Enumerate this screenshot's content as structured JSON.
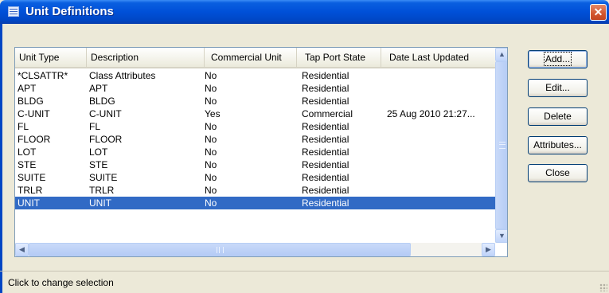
{
  "window": {
    "title": "Unit Definitions",
    "close_glyph": "✕"
  },
  "table": {
    "columns": [
      "Unit Type",
      "Description",
      "Commercial Unit",
      "Tap Port State",
      "Date Last Updated"
    ],
    "rows": [
      [
        "*CLSATTR*",
        "Class Attributes",
        "No",
        "Residential",
        ""
      ],
      [
        "APT",
        "APT",
        "No",
        "Residential",
        ""
      ],
      [
        "BLDG",
        "BLDG",
        "No",
        "Residential",
        ""
      ],
      [
        "C-UNIT",
        "C-UNIT",
        "Yes",
        "Commercial",
        "25 Aug 2010 21:27..."
      ],
      [
        "FL",
        "FL",
        "No",
        "Residential",
        ""
      ],
      [
        "FLOOR",
        "FLOOR",
        "No",
        "Residential",
        ""
      ],
      [
        "LOT",
        "LOT",
        "No",
        "Residential",
        ""
      ],
      [
        "STE",
        "STE",
        "No",
        "Residential",
        ""
      ],
      [
        "SUITE",
        "SUITE",
        "No",
        "Residential",
        ""
      ],
      [
        "TRLR",
        "TRLR",
        "No",
        "Residential",
        ""
      ],
      [
        "UNIT",
        "UNIT",
        "No",
        "Residential",
        ""
      ]
    ],
    "selected_row": "UNIT"
  },
  "buttons": {
    "add": "Add...",
    "edit": "Edit...",
    "delete": "Delete",
    "attributes": "Attributes...",
    "close": "Close"
  },
  "status": {
    "text": "Click to change selection"
  },
  "icons": {
    "window": "grid-table-icon",
    "close": "close-icon",
    "scroll_up": "chevron-up-icon",
    "scroll_down": "chevron-down-icon",
    "scroll_left": "chevron-left-icon",
    "scroll_right": "chevron-right-icon"
  },
  "colors": {
    "titlebar": "#0050d8",
    "selection": "#316ac5",
    "close_button": "#d2542d"
  }
}
